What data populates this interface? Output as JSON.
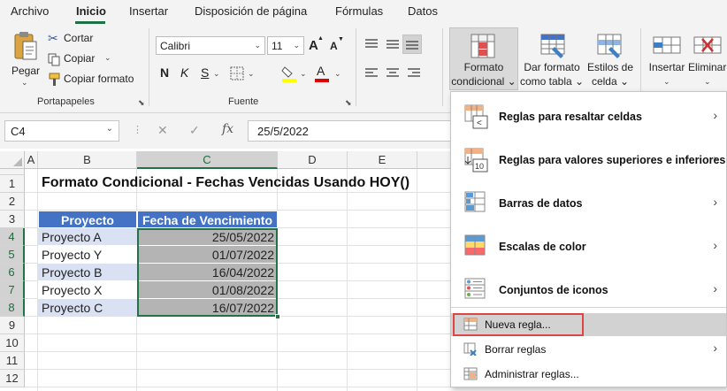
{
  "menu_tabs": [
    "Archivo",
    "Inicio",
    "Insertar",
    "Disposición de página",
    "Fórmulas",
    "Datos"
  ],
  "ribbon": {
    "clipboard": {
      "paste": "Pegar",
      "cut": "Cortar",
      "copy": "Copiar",
      "copy_chevron": "⌄",
      "format_painter": "Copiar formato",
      "group_label": "Portapapeles"
    },
    "font": {
      "name": "Calibri",
      "size": "11",
      "grow": "A",
      "shrink": "A",
      "bold": "N",
      "italic": "K",
      "underline": "S",
      "font_color_letter": "A",
      "group_label": "Fuente"
    },
    "styles": {
      "conditional_line1": "Formato",
      "conditional_line2": "condicional ⌄",
      "table_line1": "Dar formato",
      "table_line2": "como tabla ⌄",
      "cell_line1": "Estilos de",
      "cell_line2": "celda ⌄"
    },
    "cells": {
      "insert": "Insertar",
      "delete": "Eliminar"
    }
  },
  "formula_bar": {
    "name_box": "C4",
    "cancel": "✕",
    "enter": "✓",
    "fx": "fx",
    "formula": "25/5/2022"
  },
  "sheet": {
    "columns": [
      "A",
      "B",
      "C",
      "D",
      "E"
    ],
    "rows": [
      "1",
      "2",
      "3",
      "4",
      "5",
      "6",
      "7",
      "8",
      "9",
      "10",
      "11",
      "12"
    ],
    "title": "Formato Condicional - Fechas Vencidas Usando HOY()",
    "table_header": [
      "Proyecto",
      "Fecha de Vencimiento"
    ],
    "table_rows": [
      {
        "project": "Proyecto A",
        "date": "25/05/2022"
      },
      {
        "project": "Proyecto Y",
        "date": "01/07/2022"
      },
      {
        "project": "Proyecto B",
        "date": "16/04/2022"
      },
      {
        "project": "Proyecto X",
        "date": "01/08/2022"
      },
      {
        "project": "Proyecto C",
        "date": "16/07/2022"
      }
    ]
  },
  "dropdown": {
    "highlight_rules": "Reglas para resaltar celdas",
    "top_bottom_rules": "Reglas para valores superiores e inferiores",
    "data_bars": "Barras de datos",
    "color_scales": "Escalas de color",
    "icon_sets": "Conjuntos de iconos",
    "new_rule": "Nueva regla...",
    "clear_rules": "Borrar reglas",
    "manage_rules": "Administrar reglas...",
    "arrow": "›"
  },
  "colors": {
    "accent": "#217346",
    "table_header": "#4472c4",
    "table_alt_row": "#d9e1f2",
    "date_highlight": "#b4b4b4",
    "callout": "#e04545"
  }
}
